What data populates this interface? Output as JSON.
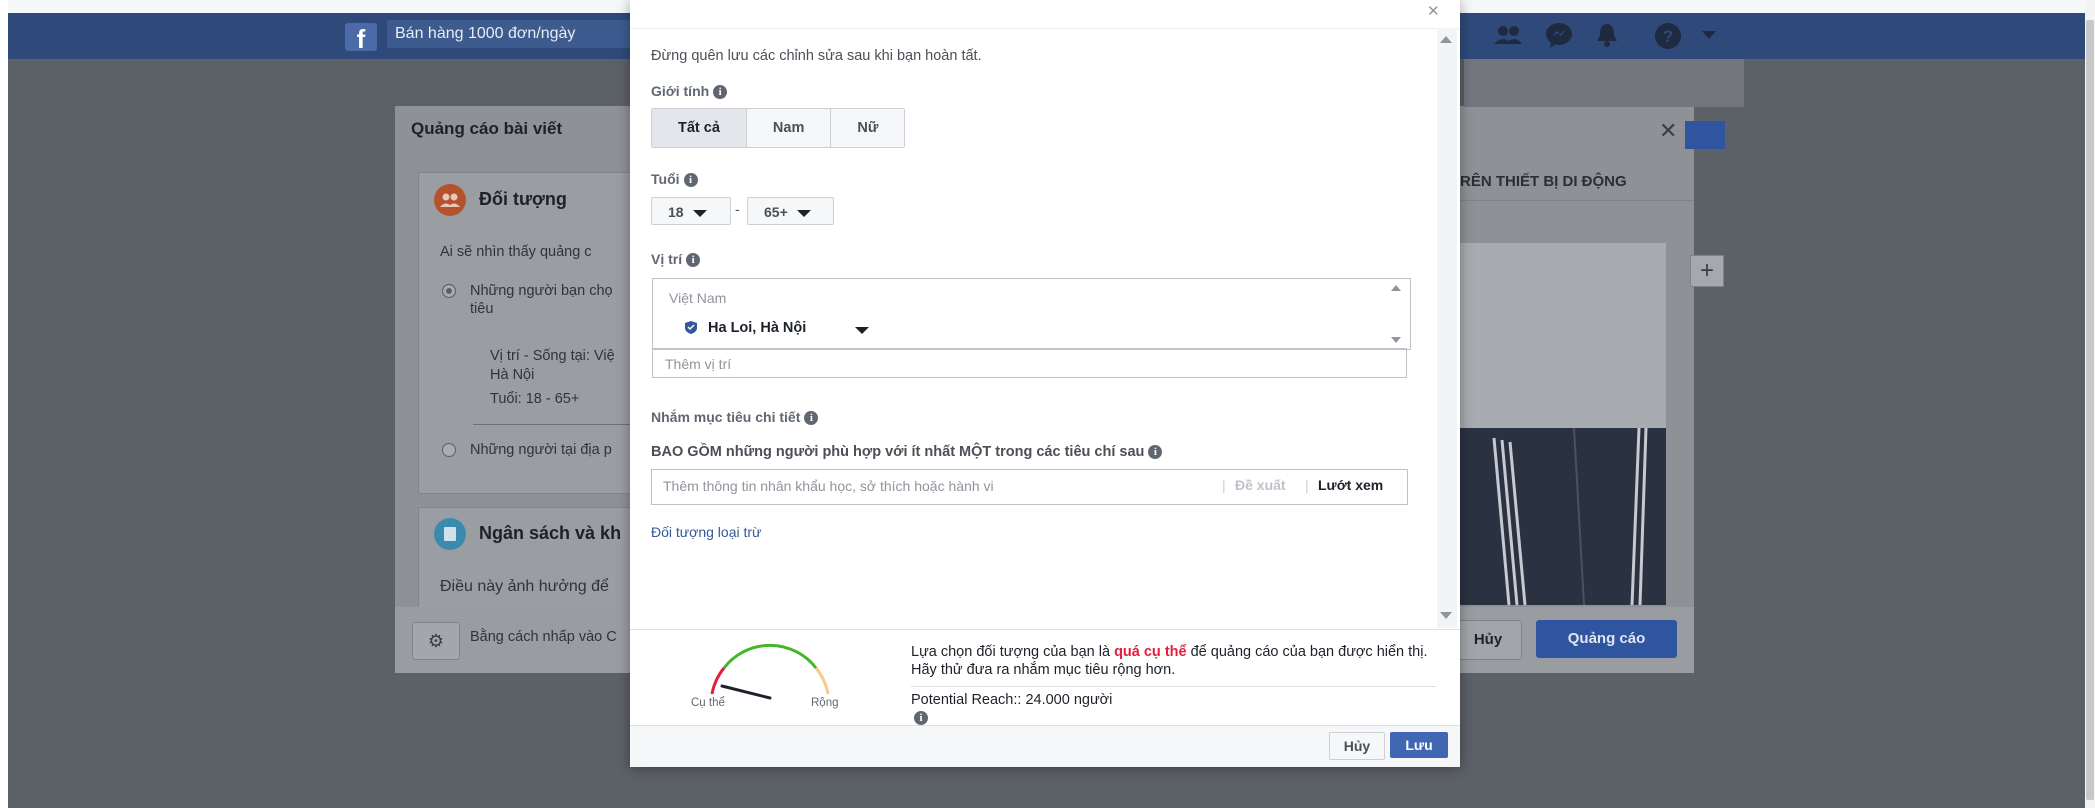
{
  "topbar": {
    "site_search": "Bán hàng 1000 đơn/ngày"
  },
  "post_modal": {
    "title": "Quảng cáo bài viết",
    "audience_title": "Đối tượng",
    "audience_question": "Ai sẽ nhìn thấy quảng c",
    "option_selected": "Những người bạn chọ",
    "option_selected_line2": "tiêu",
    "summary_location": "Vị trí - Sống tại: Việ",
    "summary_city": "Hà Nội",
    "summary_age": "Tuổi: 18 - 65+",
    "option_other": "Những người tại địa p",
    "budget_title": "Ngân sách và kh",
    "budget_text": "Điều này ảnh hưởng để",
    "footer_text": "Bằng cách nhấp vào C",
    "mobile_tab": "RÊN THIẾT BỊ DI ĐỘNG",
    "cancel": "Hủy",
    "promote": "Quảng cáo",
    "plus": "+"
  },
  "dialog": {
    "hint": "Đừng quên lưu các chỉnh sửa sau khi bạn hoàn tất.",
    "gender_label": "Giới tính",
    "gender_options": [
      "Tất cả",
      "Nam",
      "Nữ"
    ],
    "gender_selected": "Tất cả",
    "age_label": "Tuổi",
    "age_min": "18",
    "age_sep": "-",
    "age_max": "65+",
    "location_label": "Vị trí",
    "location_country": "Việt Nam",
    "location_city": "Ha Loi, Hà Nội",
    "location_add_placeholder": "Thêm vị trí",
    "detail_label": "Nhắm mục tiêu chi tiết",
    "include_label": "BAO GỒM những người phù hợp với ít nhất MỘT trong các tiêu chí sau",
    "detail_placeholder": "Thêm thông tin nhân khẩu học, sở thích hoặc hành vi",
    "suggest": "Đề xuất",
    "browse": "Lướt xem",
    "exclude_link": "Đối tượng loại trừ",
    "reach_pre": "Lựa chọn đối tượng của bạn là ",
    "reach_em": "quá cụ thể",
    "reach_post": " để quảng cáo của bạn được hiển thị. Hãy thử đưa ra nhắm mục tiêu rộng hơn.",
    "potential_reach": "Potential Reach:: 24.000 người",
    "gauge_specific": "Cụ thể",
    "gauge_broad": "Rộng",
    "cancel": "Hủy",
    "save": "Lưu"
  },
  "colors": {
    "facebook_blue": "#4267b2",
    "warning_red": "#e41e3f",
    "gauge_green": "#42b72a"
  },
  "icons": [
    "facebook-logo-icon",
    "friends-icon",
    "messenger-icon",
    "bell-icon",
    "help-icon",
    "info-icon",
    "location-pin-icon",
    "gear-icon",
    "close-icon"
  ]
}
